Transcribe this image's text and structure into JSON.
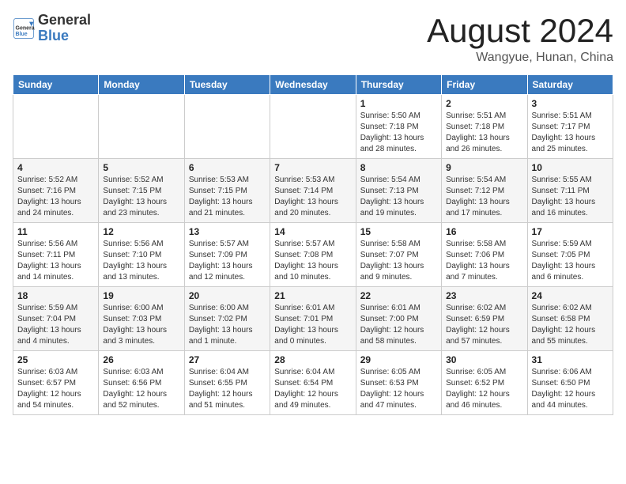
{
  "header": {
    "logo_general": "General",
    "logo_blue": "Blue",
    "month_title": "August 2024",
    "location": "Wangyue, Hunan, China"
  },
  "days_of_week": [
    "Sunday",
    "Monday",
    "Tuesday",
    "Wednesday",
    "Thursday",
    "Friday",
    "Saturday"
  ],
  "weeks": [
    {
      "row_bg": "white",
      "days": [
        {
          "num": "",
          "info": ""
        },
        {
          "num": "",
          "info": ""
        },
        {
          "num": "",
          "info": ""
        },
        {
          "num": "",
          "info": ""
        },
        {
          "num": "1",
          "info": "Sunrise: 5:50 AM\nSunset: 7:18 PM\nDaylight: 13 hours\nand 28 minutes."
        },
        {
          "num": "2",
          "info": "Sunrise: 5:51 AM\nSunset: 7:18 PM\nDaylight: 13 hours\nand 26 minutes."
        },
        {
          "num": "3",
          "info": "Sunrise: 5:51 AM\nSunset: 7:17 PM\nDaylight: 13 hours\nand 25 minutes."
        }
      ]
    },
    {
      "row_bg": "gray",
      "days": [
        {
          "num": "4",
          "info": "Sunrise: 5:52 AM\nSunset: 7:16 PM\nDaylight: 13 hours\nand 24 minutes."
        },
        {
          "num": "5",
          "info": "Sunrise: 5:52 AM\nSunset: 7:15 PM\nDaylight: 13 hours\nand 23 minutes."
        },
        {
          "num": "6",
          "info": "Sunrise: 5:53 AM\nSunset: 7:15 PM\nDaylight: 13 hours\nand 21 minutes."
        },
        {
          "num": "7",
          "info": "Sunrise: 5:53 AM\nSunset: 7:14 PM\nDaylight: 13 hours\nand 20 minutes."
        },
        {
          "num": "8",
          "info": "Sunrise: 5:54 AM\nSunset: 7:13 PM\nDaylight: 13 hours\nand 19 minutes."
        },
        {
          "num": "9",
          "info": "Sunrise: 5:54 AM\nSunset: 7:12 PM\nDaylight: 13 hours\nand 17 minutes."
        },
        {
          "num": "10",
          "info": "Sunrise: 5:55 AM\nSunset: 7:11 PM\nDaylight: 13 hours\nand 16 minutes."
        }
      ]
    },
    {
      "row_bg": "white",
      "days": [
        {
          "num": "11",
          "info": "Sunrise: 5:56 AM\nSunset: 7:11 PM\nDaylight: 13 hours\nand 14 minutes."
        },
        {
          "num": "12",
          "info": "Sunrise: 5:56 AM\nSunset: 7:10 PM\nDaylight: 13 hours\nand 13 minutes."
        },
        {
          "num": "13",
          "info": "Sunrise: 5:57 AM\nSunset: 7:09 PM\nDaylight: 13 hours\nand 12 minutes."
        },
        {
          "num": "14",
          "info": "Sunrise: 5:57 AM\nSunset: 7:08 PM\nDaylight: 13 hours\nand 10 minutes."
        },
        {
          "num": "15",
          "info": "Sunrise: 5:58 AM\nSunset: 7:07 PM\nDaylight: 13 hours\nand 9 minutes."
        },
        {
          "num": "16",
          "info": "Sunrise: 5:58 AM\nSunset: 7:06 PM\nDaylight: 13 hours\nand 7 minutes."
        },
        {
          "num": "17",
          "info": "Sunrise: 5:59 AM\nSunset: 7:05 PM\nDaylight: 13 hours\nand 6 minutes."
        }
      ]
    },
    {
      "row_bg": "gray",
      "days": [
        {
          "num": "18",
          "info": "Sunrise: 5:59 AM\nSunset: 7:04 PM\nDaylight: 13 hours\nand 4 minutes."
        },
        {
          "num": "19",
          "info": "Sunrise: 6:00 AM\nSunset: 7:03 PM\nDaylight: 13 hours\nand 3 minutes."
        },
        {
          "num": "20",
          "info": "Sunrise: 6:00 AM\nSunset: 7:02 PM\nDaylight: 13 hours\nand 1 minute."
        },
        {
          "num": "21",
          "info": "Sunrise: 6:01 AM\nSunset: 7:01 PM\nDaylight: 13 hours\nand 0 minutes."
        },
        {
          "num": "22",
          "info": "Sunrise: 6:01 AM\nSunset: 7:00 PM\nDaylight: 12 hours\nand 58 minutes."
        },
        {
          "num": "23",
          "info": "Sunrise: 6:02 AM\nSunset: 6:59 PM\nDaylight: 12 hours\nand 57 minutes."
        },
        {
          "num": "24",
          "info": "Sunrise: 6:02 AM\nSunset: 6:58 PM\nDaylight: 12 hours\nand 55 minutes."
        }
      ]
    },
    {
      "row_bg": "white",
      "days": [
        {
          "num": "25",
          "info": "Sunrise: 6:03 AM\nSunset: 6:57 PM\nDaylight: 12 hours\nand 54 minutes."
        },
        {
          "num": "26",
          "info": "Sunrise: 6:03 AM\nSunset: 6:56 PM\nDaylight: 12 hours\nand 52 minutes."
        },
        {
          "num": "27",
          "info": "Sunrise: 6:04 AM\nSunset: 6:55 PM\nDaylight: 12 hours\nand 51 minutes."
        },
        {
          "num": "28",
          "info": "Sunrise: 6:04 AM\nSunset: 6:54 PM\nDaylight: 12 hours\nand 49 minutes."
        },
        {
          "num": "29",
          "info": "Sunrise: 6:05 AM\nSunset: 6:53 PM\nDaylight: 12 hours\nand 47 minutes."
        },
        {
          "num": "30",
          "info": "Sunrise: 6:05 AM\nSunset: 6:52 PM\nDaylight: 12 hours\nand 46 minutes."
        },
        {
          "num": "31",
          "info": "Sunrise: 6:06 AM\nSunset: 6:50 PM\nDaylight: 12 hours\nand 44 minutes."
        }
      ]
    }
  ]
}
